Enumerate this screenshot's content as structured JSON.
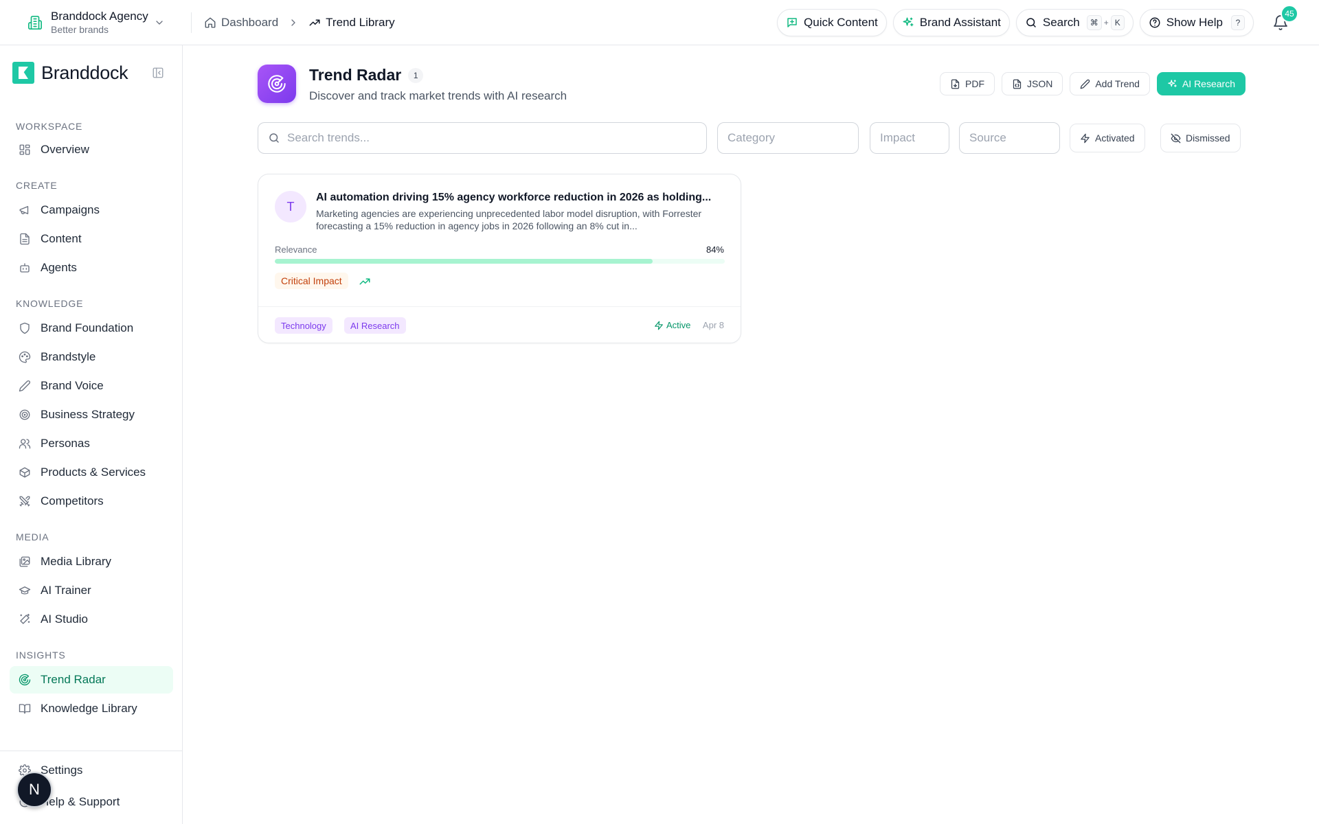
{
  "topbar": {
    "org_name": "Branddock Agency",
    "org_sub": "Better brands",
    "breadcrumb": [
      "Dashboard",
      "Trend Library"
    ],
    "quick_content": "Quick Content",
    "brand_assistant": "Brand Assistant",
    "search": "Search",
    "search_kbd": [
      "⌘",
      "+",
      "K"
    ],
    "show_help": "Show Help",
    "help_kbd": "?",
    "notifications_count": "45"
  },
  "sidebar": {
    "logo": "Branddock",
    "sections": [
      {
        "title": "Workspace",
        "items": [
          {
            "label": "Overview",
            "icon": "grid-icon"
          }
        ]
      },
      {
        "title": "Create",
        "items": [
          {
            "label": "Campaigns",
            "icon": "megaphone-icon"
          },
          {
            "label": "Content",
            "icon": "document-icon"
          },
          {
            "label": "Agents",
            "icon": "bot-icon"
          }
        ]
      },
      {
        "title": "Knowledge",
        "items": [
          {
            "label": "Brand Foundation",
            "icon": "shield-icon"
          },
          {
            "label": "Brandstyle",
            "icon": "palette-icon"
          },
          {
            "label": "Brand Voice",
            "icon": "pen-icon"
          },
          {
            "label": "Business Strategy",
            "icon": "target-icon"
          },
          {
            "label": "Personas",
            "icon": "users-icon"
          },
          {
            "label": "Products & Services",
            "icon": "package-icon"
          },
          {
            "label": "Competitors",
            "icon": "swords-icon"
          }
        ]
      },
      {
        "title": "Media",
        "items": [
          {
            "label": "Media Library",
            "icon": "images-icon"
          },
          {
            "label": "AI Trainer",
            "icon": "graduation-cap-icon"
          },
          {
            "label": "AI Studio",
            "icon": "wand-icon"
          }
        ]
      },
      {
        "title": "Insights",
        "items": [
          {
            "label": "Trend Radar",
            "icon": "radar-icon"
          },
          {
            "label": "Knowledge Library",
            "icon": "book-icon"
          }
        ]
      }
    ],
    "active_item": "Trend Radar",
    "bottom": [
      "Settings",
      "Help & Support"
    ],
    "avatar": "N"
  },
  "header": {
    "title": "Trend Radar",
    "count": "1",
    "subtitle": "Discover and track market trends with AI research",
    "actions": {
      "pdf": "PDF",
      "json": "JSON",
      "add": "Add Trend",
      "ai": "AI Research"
    }
  },
  "filters": {
    "search_placeholder": "Search trends...",
    "category": "Category",
    "impact": "Impact",
    "source": "Source",
    "activated": "Activated",
    "dismissed": "Dismissed"
  },
  "trends": [
    {
      "avatar": "T",
      "title": "AI automation driving 15% agency workforce reduction in 2026 as holding...",
      "description": "Marketing agencies are experiencing unprecedented labor model disruption, with Forrester forecasting a 15% reduction in agency jobs in 2026 following an 8% cut in...",
      "relevance_label": "Relevance",
      "relevance": "84%",
      "relevance_fraction": 0.84,
      "impact": "Critical Impact",
      "tags": [
        "Technology",
        "AI Research"
      ],
      "status": "Active",
      "date": "Apr 8"
    }
  ],
  "colors": {
    "accent": "#1ec8a5",
    "purple": "#7c3aed",
    "impact_text": "#c2410c"
  }
}
